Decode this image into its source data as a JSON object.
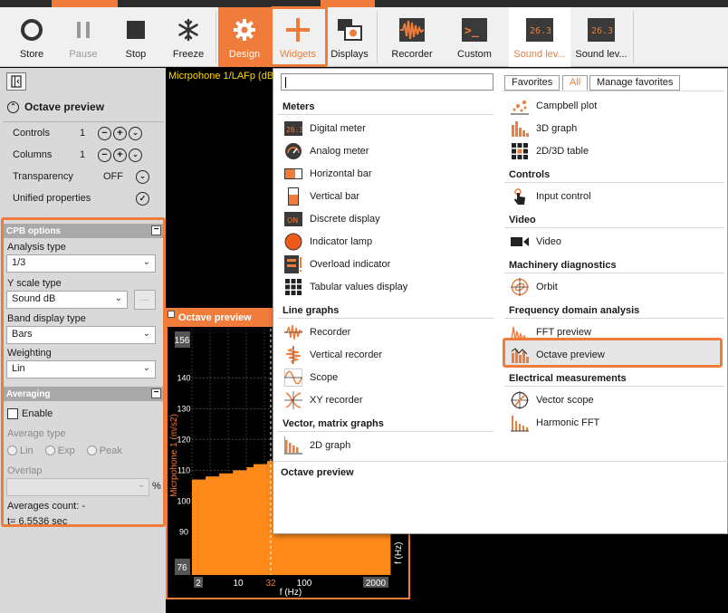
{
  "toolbar": {
    "store": "Store",
    "pause": "Pause",
    "stop": "Stop",
    "freeze": "Freeze",
    "design": "Design",
    "widgets": "Widgets",
    "displays": "Displays",
    "recorder": "Recorder",
    "custom": "Custom",
    "sound1": "Sound lev...",
    "sound2": "Sound lev...",
    "meter_value": "26.3",
    "custom_glyph": ">_"
  },
  "left": {
    "title": "Octave preview",
    "controls_label": "Controls",
    "controls_value": "1",
    "columns_label": "Columns",
    "columns_value": "1",
    "transparency_label": "Transparency",
    "transparency_value": "OFF",
    "unified_label": "Unified properties",
    "cpb_header": "CPB options",
    "analysis_label": "Analysis type",
    "analysis_value": "1/3",
    "yscale_label": "Y scale type",
    "yscale_value": "Sound dB",
    "band_label": "Band display type",
    "band_value": "Bars",
    "weight_label": "Weighting",
    "weight_value": "Lin",
    "avg_header": "Averaging",
    "enable": "Enable",
    "avgtype_label": "Average type",
    "lin": "Lin",
    "exp": "Exp",
    "peak": "Peak",
    "overlap_label": "Overlap",
    "percent": "%",
    "avg_count": "Averages count: -",
    "t_value": "t= 6.5536 sec",
    "ellipsis": "..."
  },
  "plot": {
    "channel_header": "Micrpohone 1/LAFp (dB",
    "widget_title": "Octave preview",
    "y_ticks": [
      "140",
      "130",
      "120",
      "110",
      "100",
      "90"
    ],
    "y_top": "156",
    "y_bottom": "76",
    "ylabel": "Micrpohone 1 (m/s2)",
    "x_ticks": [
      "2",
      "10",
      "32",
      "100",
      "2000"
    ],
    "xlabel": "f (Hz)",
    "right_label": "f (Hz)"
  },
  "popup": {
    "tabs": {
      "favorites": "Favorites",
      "all": "All",
      "manage": "Manage favorites"
    },
    "meters": "Meters",
    "digital_meter": "Digital meter",
    "analog_meter": "Analog meter",
    "horizontal_bar": "Horizontal bar",
    "vertical_bar": "Vertical bar",
    "discrete_display": "Discrete display",
    "on_text": "ON",
    "indicator_lamp": "Indicator lamp",
    "overload_indicator": "Overload indicator",
    "tabular_values": "Tabular values display",
    "line_graphs": "Line graphs",
    "recorder": "Recorder",
    "vertical_recorder": "Vertical recorder",
    "scope": "Scope",
    "xy_recorder": "XY recorder",
    "vector_matrix": "Vector, matrix graphs",
    "graph2d": "2D graph",
    "campbell": "Campbell plot",
    "graph3d": "3D graph",
    "table2d3d": "2D/3D table",
    "controls": "Controls",
    "input_control": "Input control",
    "video_cat": "Video",
    "video": "Video",
    "machinery": "Machinery diagnostics",
    "orbit": "Orbit",
    "freq": "Frequency domain analysis",
    "fft_preview": "FFT preview",
    "octave_preview": "Octave preview",
    "electrical": "Electrical measurements",
    "vector_scope": "Vector scope",
    "harmonic_fft": "Harmonic FFT",
    "footer": "Octave preview"
  },
  "colors": {
    "accent": "#ef7c3a",
    "bar": "#ff8a1a"
  }
}
